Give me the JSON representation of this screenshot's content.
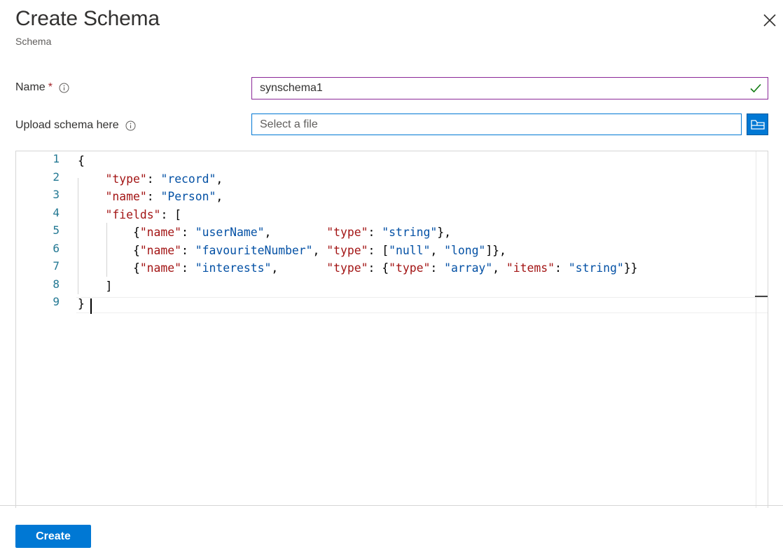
{
  "panel": {
    "title": "Create Schema",
    "subtitle": "Schema"
  },
  "form": {
    "name": {
      "label": "Name",
      "required_mark": "*",
      "value": "synschema1"
    },
    "upload": {
      "label": "Upload schema here",
      "placeholder": "Select a file"
    }
  },
  "editor": {
    "line_numbers": [
      "1",
      "2",
      "3",
      "4",
      "5",
      "6",
      "7",
      "8",
      "9"
    ],
    "lines": [
      [
        {
          "t": "p",
          "v": "{"
        }
      ],
      [
        {
          "t": "p",
          "v": "    "
        },
        {
          "t": "k",
          "v": "\"type\""
        },
        {
          "t": "p",
          "v": ": "
        },
        {
          "t": "s",
          "v": "\"record\""
        },
        {
          "t": "p",
          "v": ","
        }
      ],
      [
        {
          "t": "p",
          "v": "    "
        },
        {
          "t": "k",
          "v": "\"name\""
        },
        {
          "t": "p",
          "v": ": "
        },
        {
          "t": "s",
          "v": "\"Person\""
        },
        {
          "t": "p",
          "v": ","
        }
      ],
      [
        {
          "t": "p",
          "v": "    "
        },
        {
          "t": "k",
          "v": "\"fields\""
        },
        {
          "t": "p",
          "v": ": ["
        }
      ],
      [
        {
          "t": "p",
          "v": "        {"
        },
        {
          "t": "k",
          "v": "\"name\""
        },
        {
          "t": "p",
          "v": ": "
        },
        {
          "t": "s",
          "v": "\"userName\""
        },
        {
          "t": "p",
          "v": ",        "
        },
        {
          "t": "k",
          "v": "\"type\""
        },
        {
          "t": "p",
          "v": ": "
        },
        {
          "t": "s",
          "v": "\"string\""
        },
        {
          "t": "p",
          "v": "},"
        }
      ],
      [
        {
          "t": "p",
          "v": "        {"
        },
        {
          "t": "k",
          "v": "\"name\""
        },
        {
          "t": "p",
          "v": ": "
        },
        {
          "t": "s",
          "v": "\"favouriteNumber\""
        },
        {
          "t": "p",
          "v": ", "
        },
        {
          "t": "k",
          "v": "\"type\""
        },
        {
          "t": "p",
          "v": ": ["
        },
        {
          "t": "s",
          "v": "\"null\""
        },
        {
          "t": "p",
          "v": ", "
        },
        {
          "t": "s",
          "v": "\"long\""
        },
        {
          "t": "p",
          "v": "]},"
        }
      ],
      [
        {
          "t": "p",
          "v": "        {"
        },
        {
          "t": "k",
          "v": "\"name\""
        },
        {
          "t": "p",
          "v": ": "
        },
        {
          "t": "s",
          "v": "\"interests\""
        },
        {
          "t": "p",
          "v": ",       "
        },
        {
          "t": "k",
          "v": "\"type\""
        },
        {
          "t": "p",
          "v": ": {"
        },
        {
          "t": "k",
          "v": "\"type\""
        },
        {
          "t": "p",
          "v": ": "
        },
        {
          "t": "s",
          "v": "\"array\""
        },
        {
          "t": "p",
          "v": ", "
        },
        {
          "t": "k",
          "v": "\"items\""
        },
        {
          "t": "p",
          "v": ": "
        },
        {
          "t": "s",
          "v": "\"string\""
        },
        {
          "t": "p",
          "v": "}}"
        }
      ],
      [
        {
          "t": "p",
          "v": "    ]"
        }
      ],
      [
        {
          "t": "p",
          "v": "}"
        }
      ]
    ]
  },
  "footer": {
    "create_label": "Create"
  },
  "colors": {
    "accent": "#0078d4",
    "name_border": "#8a2898",
    "valid_check": "#107c10",
    "json_key": "#a31515",
    "json_string": "#0451a5",
    "line_number": "#237893"
  },
  "icons": {
    "close": "close-icon",
    "info": "info-icon",
    "valid": "checkmark-icon",
    "browse": "folder-icon"
  }
}
